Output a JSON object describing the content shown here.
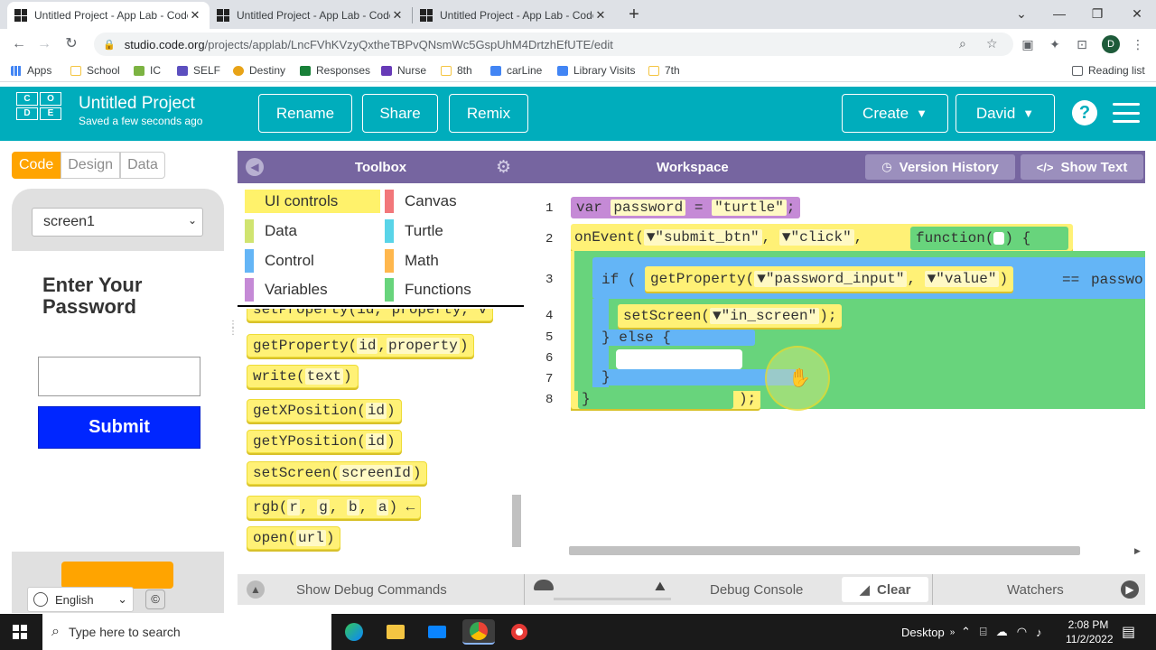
{
  "browser": {
    "tabs": [
      {
        "title": "Untitled Project - App Lab - Code.org",
        "active": true
      },
      {
        "title": "Untitled Project - App Lab - Code.org",
        "active": false
      },
      {
        "title": "Untitled Project - App Lab - Code.org",
        "active": false
      }
    ],
    "url_host": "studio.code.org",
    "url_path": "/projects/applab/LncFVhKVzyQxtheTBPvQNsmWc5GspUhM4DrtzhEfUTE/edit",
    "profile_initial": "D",
    "bookmarks": [
      {
        "label": "Apps",
        "color": "#4285f4"
      },
      {
        "label": "School",
        "color": "#f4c542"
      },
      {
        "label": "IC",
        "color": "#7cb342"
      },
      {
        "label": "SELF",
        "color": "#5c4fbf"
      },
      {
        "label": "Destiny",
        "color": "#e8a317"
      },
      {
        "label": "Responses",
        "color": "#188038"
      },
      {
        "label": "Nurse",
        "color": "#673ab7"
      },
      {
        "label": "8th",
        "color": "#f4c542"
      },
      {
        "label": "carLine",
        "color": "#4285f4"
      },
      {
        "label": "Library Visits",
        "color": "#4285f4"
      },
      {
        "label": "7th",
        "color": "#f4c542"
      }
    ],
    "reading_list": "Reading list"
  },
  "header": {
    "logo_letters": [
      "C",
      "O",
      "D",
      "E"
    ],
    "project_title": "Untitled Project",
    "saved_status": "Saved a few seconds ago",
    "rename": "Rename",
    "share": "Share",
    "remix": "Remix",
    "create": "Create",
    "user": "David",
    "help": "?"
  },
  "left": {
    "modes": [
      "Code",
      "Design",
      "Data"
    ],
    "screen_select": "screen1",
    "app_heading": "Enter Your Password",
    "submit_label": "Submit",
    "language": "English",
    "copyright": "©"
  },
  "toolbox": {
    "title": "Toolbox",
    "categories": [
      {
        "label": "UI controls",
        "color": "#fff26b"
      },
      {
        "label": "Canvas",
        "color": "#f2777a"
      },
      {
        "label": "Data",
        "color": "#d0e470"
      },
      {
        "label": "Turtle",
        "color": "#59d4e8"
      },
      {
        "label": "Control",
        "color": "#64b5f6"
      },
      {
        "label": "Math",
        "color": "#ffb74d"
      },
      {
        "label": "Variables",
        "color": "#c58ad6"
      },
      {
        "label": "Functions",
        "color": "#68d47c"
      }
    ],
    "blocks": {
      "partial": "setProperty(id, property, v",
      "getProperty": {
        "fn": "getProperty(",
        "a1": "id",
        "sep": ", ",
        "a2": "property",
        "end": ")"
      },
      "write": {
        "fn": "write(",
        "a1": "text",
        "end": ")"
      },
      "getX": {
        "fn": "getXPosition(",
        "a1": "id",
        "end": ")"
      },
      "getY": {
        "fn": "getYPosition(",
        "a1": "id",
        "end": ")"
      },
      "setScreen": {
        "fn": "setScreen(",
        "a1": "screenId",
        "end": ")"
      },
      "rgb": {
        "fn": "rgb(",
        "a1": "r",
        "a2": "g",
        "a3": "b",
        "a4": "a",
        "end": ") ←"
      },
      "open": {
        "fn": "open(",
        "a1": "url",
        "end": ")"
      }
    }
  },
  "workspace": {
    "title": "Workspace",
    "version_history": "Version History",
    "show_text": "Show Text",
    "line_numbers": [
      "1",
      "2",
      "3",
      "4",
      "5",
      "6",
      "7",
      "8"
    ],
    "code": {
      "l1_var": "var",
      "l1_name": "password",
      "l1_eq": "=",
      "l1_str": "\"turtle\"",
      "l1_end": ";",
      "l2_fn": "onEvent(",
      "l2_arg1": "▼\"submit_btn\"",
      "l2_sep": ",",
      "l2_arg2": "▼\"click\"",
      "l2_func": "function(",
      "l2_func_end": ") {",
      "l3_if": "if (",
      "l3_get": "getProperty(",
      "l3_arg1": "▼\"password_input\"",
      "l3_arg2": "▼\"value\"",
      "l3_close": ")",
      "l3_op": "==",
      "l3_rhs": "passwo",
      "l4_fn": "setScreen(",
      "l4_arg": "▼\"in_screen\"",
      "l4_end": ");",
      "l5_else": "} else {",
      "l7_close": "}",
      "l8_close": "}",
      "l8_end": ");"
    }
  },
  "debug": {
    "show_commands": "Show Debug Commands",
    "console": "Debug Console",
    "clear": "Clear",
    "watchers": "Watchers"
  },
  "taskbar": {
    "search_placeholder": "Type here to search",
    "desktop": "Desktop",
    "time": "2:08 PM",
    "date": "11/2/2022"
  }
}
